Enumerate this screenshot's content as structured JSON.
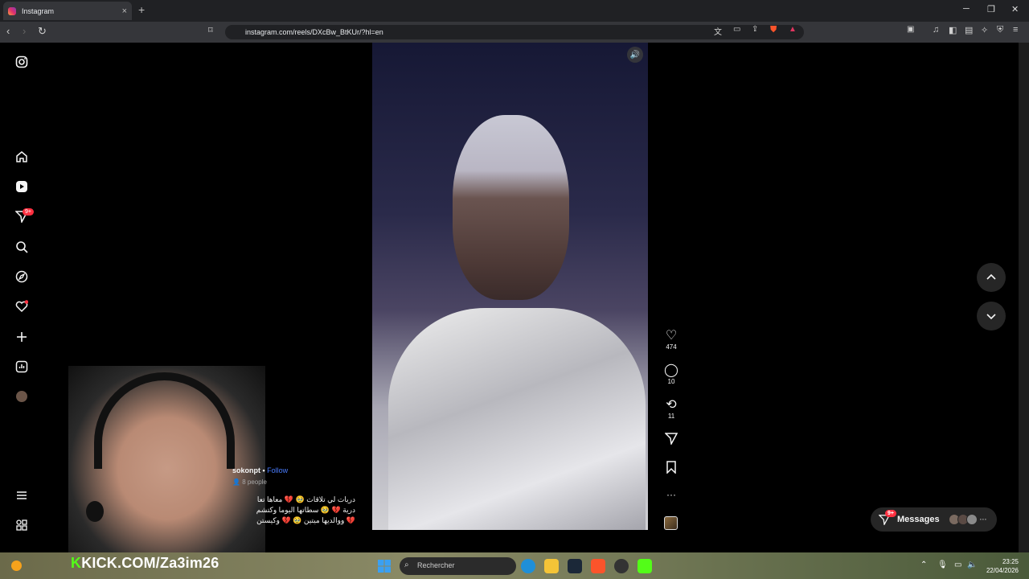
{
  "browser": {
    "tab_title": "Instagram",
    "tab_close": "×",
    "new_tab": "+",
    "url": "instagram.com/reels/DXcBw_BtKUr/?hl=en",
    "window_controls": [
      "─",
      "❐",
      "✕"
    ]
  },
  "sidebar": {
    "notification_badge": "9+"
  },
  "reel": {
    "username": "sokonpt",
    "follow_label": "Follow",
    "people": "8 people",
    "caption_lines": [
      "دريات لي تلاقات 🥹 💔 معاها تعا",
      "درية 💔 🥹 سطاتها اليوما وكتشم",
      "💔 ووالديها ميتين 🥹 💔 وكيستن"
    ],
    "likes": "474",
    "comments": "10",
    "reposts": "11",
    "more": "···"
  },
  "messages": {
    "label": "Messages",
    "badge": "9+",
    "more": "···"
  },
  "overlay": {
    "kick_k": "K",
    "kick_text": "KICK.COM/Za3im26"
  },
  "taskbar": {
    "search_placeholder": "Rechercher",
    "time": "23:25",
    "date": "22/04/2026"
  }
}
